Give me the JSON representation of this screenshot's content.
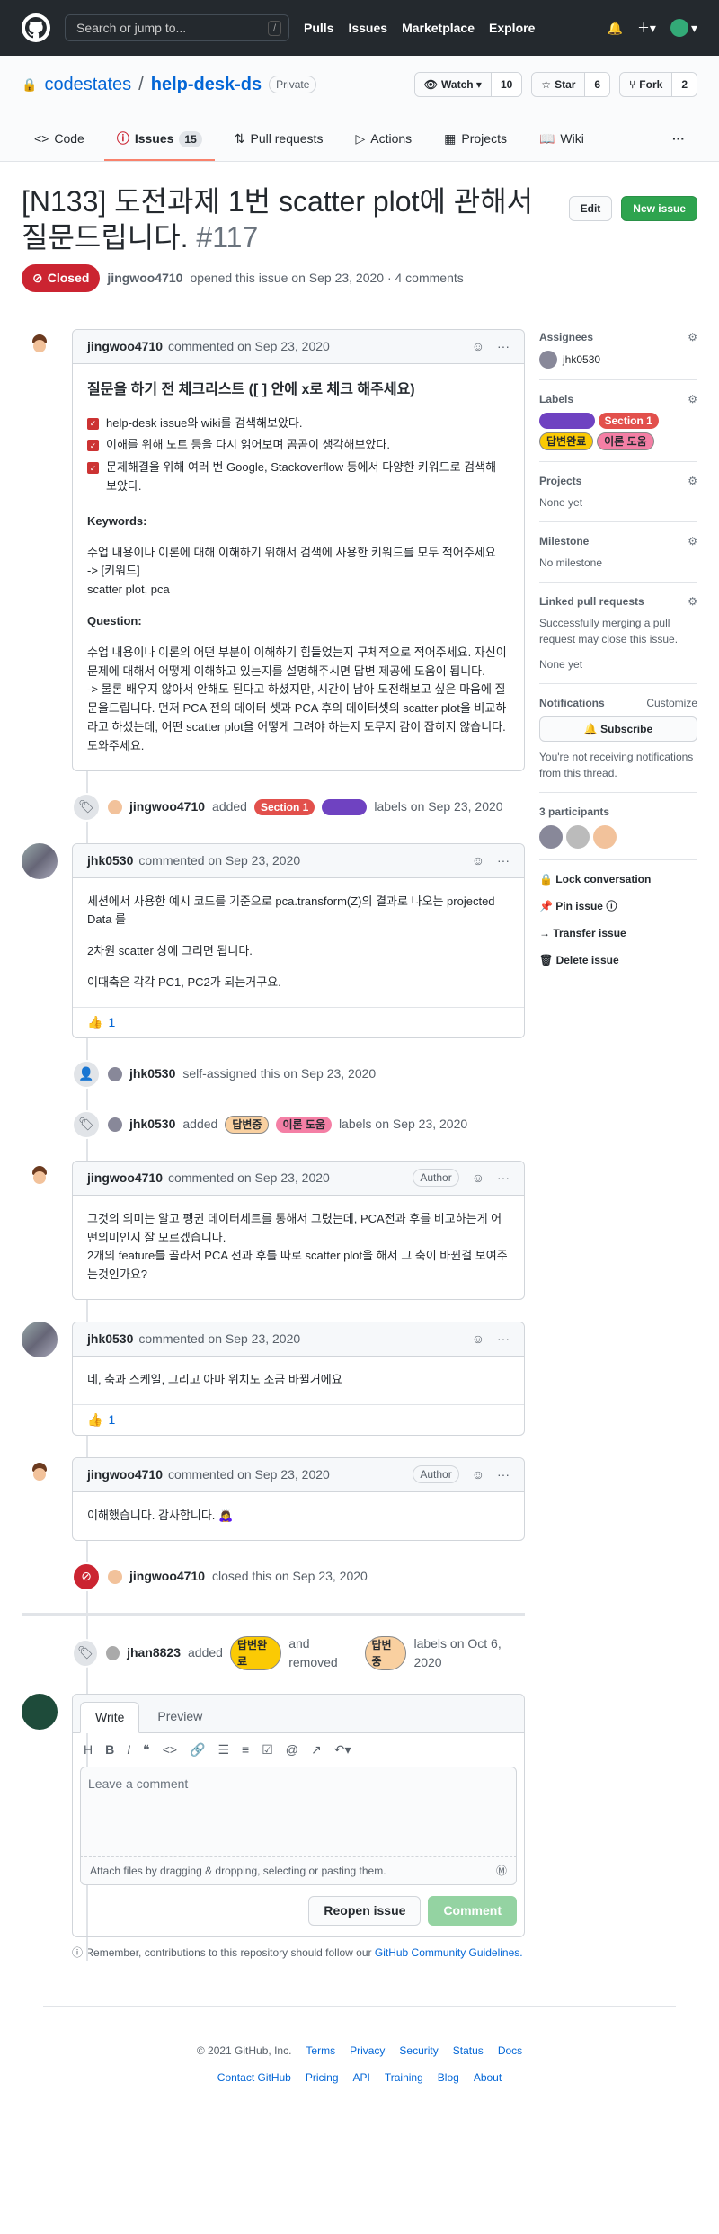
{
  "header": {
    "search_placeholder": "Search or jump to...",
    "search_key": "/",
    "nav": [
      "Pulls",
      "Issues",
      "Marketplace",
      "Explore"
    ]
  },
  "repo": {
    "owner": "codestates",
    "name": "help-desk-ds",
    "visibility": "Private",
    "watch": "Watch",
    "watch_count": "10",
    "star": "Star",
    "star_count": "6",
    "fork": "Fork",
    "fork_count": "2"
  },
  "tabs": [
    {
      "label": "Code"
    },
    {
      "label": "Issues",
      "count": "15"
    },
    {
      "label": "Pull requests"
    },
    {
      "label": "Actions"
    },
    {
      "label": "Projects"
    },
    {
      "label": "Wiki"
    }
  ],
  "issue": {
    "title": "[N133] 도전과제 1번 scatter plot에 관해서 질문드립니다.",
    "number": "#117",
    "edit": "Edit",
    "new_issue": "New issue",
    "state": "Closed",
    "author": "jingwoo4710",
    "opened_text": "opened this issue on Sep 23, 2020 · 4 comments"
  },
  "comment1": {
    "author": "jingwoo4710",
    "when": "commented on Sep 23, 2020",
    "heading": "질문을 하기 전 체크리스트 ([ ] 안에 x로 체크 해주세요)",
    "checks": [
      "help-desk issue와 wiki를 검색해보았다.",
      "이해를 위해 노트 등을 다시 읽어보며 곰곰이 생각해보았다.",
      "문제해결을 위해 여러 번 Google, Stackoverflow 등에서 다양한 키워드로 검색해 보았다."
    ],
    "kw_title": "Keywords:",
    "kw_text": "수업 내용이나 이론에 대해 이해하기 위해서 검색에 사용한 키워드를 모두 적어주세요",
    "kw_arrow": "-> [키워드]",
    "kw_words": "scatter plot, pca",
    "q_title": "Question:",
    "q_text": "수업 내용이나 이론의 어떤 부분이 이해하기 힘들었는지 구체적으로 적어주세요. 자신이 문제에 대해서 어떻게 이해하고 있는지를 설명해주시면 답변 제공에 도움이 됩니다.",
    "q_text2": "-> 물론 배우지 않아서 안해도 된다고 하셨지만, 시간이 남아 도전해보고 싶은 마음에 질문을드립니다. 먼저 PCA 전의 데이터 셋과 PCA 후의 데이터셋의 scatter plot을 비교하라고 하셨는데, 어떤 scatter plot을 어떻게 그려야 하는지 도무지 감이 잡히지 않습니다. 도와주세요."
  },
  "ev1": {
    "user": "jingwoo4710",
    "text": "added",
    "label1": "Section 1",
    "label2": "",
    "tail": "labels on Sep 23, 2020"
  },
  "comment2": {
    "author": "jhk0530",
    "when": "commented on Sep 23, 2020",
    "p1": "세션에서 사용한 예시 코드를 기준으로 pca.transform(Z)의 결과로 나오는 projected Data 를",
    "p2": "2차원 scatter 상에 그리면 됩니다.",
    "p3": "이때축은 각각 PC1, PC2가 되는거구요.",
    "reaction": "👍",
    "reaction_count": "1"
  },
  "ev2": {
    "user": "jhk0530",
    "text": "self-assigned this on Sep 23, 2020"
  },
  "ev3": {
    "user": "jhk0530",
    "text": "added",
    "label1": "답변중",
    "label2": "이론 도움",
    "tail": "labels on Sep 23, 2020"
  },
  "comment3": {
    "author": "jingwoo4710",
    "when": "commented on Sep 23, 2020",
    "badge": "Author",
    "p1": "그것의 의미는 알고 펭귄 데이터세트를 통해서 그렸는데, PCA전과 후를 비교하는게 어떤의미인지 잘 모르겠습니다.",
    "p2": "2개의 feature를 골라서 PCA 전과 후를 따로 scatter plot을 해서 그 축이 바뀐걸 보여주는것인가요?"
  },
  "comment4": {
    "author": "jhk0530",
    "when": "commented on Sep 23, 2020",
    "p1": "네, 축과 스케일, 그리고 아마 위치도 조금 바뀔거에요",
    "reaction": "👍",
    "reaction_count": "1"
  },
  "comment5": {
    "author": "jingwoo4710",
    "when": "commented on Sep 23, 2020",
    "badge": "Author",
    "p1": "이해했습니다. 감사합니다. 🙇‍♀️"
  },
  "ev4": {
    "user": "jingwoo4710",
    "text": "closed this on Sep 23, 2020"
  },
  "ev5": {
    "user": "jhan8823",
    "added": "added",
    "label1": "답변완료",
    "removed": "and removed",
    "label2": "답변중",
    "tail": "labels on Oct 6, 2020"
  },
  "editor": {
    "write": "Write",
    "preview": "Preview",
    "placeholder": "Leave a comment",
    "attach": "Attach files by dragging & dropping, selecting or pasting them.",
    "reopen": "Reopen issue",
    "comment": "Comment",
    "remember": "Remember, contributions to this repository should follow our",
    "remember_link": "GitHub Community Guidelines."
  },
  "sidebar": {
    "assignees_t": "Assignees",
    "assignee": "jhk0530",
    "labels_t": "Labels",
    "labels": [
      "이론 도움",
      "Section 1",
      "답변완료",
      "이론 도움"
    ],
    "projects_t": "Projects",
    "projects_v": "None yet",
    "milestone_t": "Milestone",
    "milestone_v": "No milestone",
    "linked_t": "Linked pull requests",
    "linked_d": "Successfully merging a pull request may close this issue.",
    "linked_v": "None yet",
    "notif_t": "Notifications",
    "customize": "Customize",
    "subscribe": "Subscribe",
    "notif_d": "You're not receiving notifications from this thread.",
    "participants": "3 participants",
    "lock": "Lock conversation",
    "pin": "Pin issue",
    "transfer": "Transfer issue",
    "delete": "Delete issue"
  },
  "footer": {
    "copy": "© 2021 GitHub, Inc.",
    "row1": [
      "Terms",
      "Privacy",
      "Security",
      "Status",
      "Docs"
    ],
    "row2": [
      "Contact GitHub",
      "Pricing",
      "API",
      "Training",
      "Blog",
      "About"
    ]
  },
  "colors": {
    "closed": "#cb2431",
    "section1": "#e2504c",
    "purple": "#6f42c1",
    "answering": "#f9d0a0",
    "theory": "#f47fa5",
    "done": "#fbca04"
  }
}
